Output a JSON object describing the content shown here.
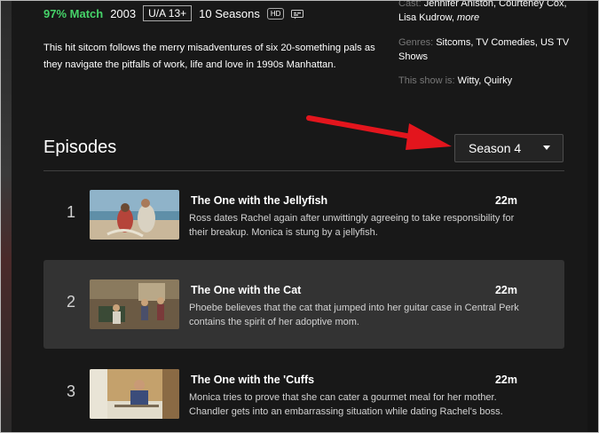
{
  "meta": {
    "match": "97% Match",
    "year": "2003",
    "rating": "U/A 13+",
    "seasons": "10 Seasons",
    "hd_badge": "HD",
    "subtitles_icon": "subtitles-icon"
  },
  "synopsis": "This hit sitcom follows the merry misadventures of six 20-something pals as they navigate the pitfalls of work, life and love in 1990s Manhattan.",
  "info": {
    "cast_label": "Cast:",
    "cast_value": "Jennifer Aniston, Courteney Cox, Lisa Kudrow,",
    "cast_more": "more",
    "genres_label": "Genres:",
    "genres_value": "Sitcoms, TV Comedies, US TV Shows",
    "tags_label": "This show is:",
    "tags_value": "Witty, Quirky"
  },
  "episodes_section": {
    "title": "Episodes",
    "season_selected": "Season 4"
  },
  "episodes": [
    {
      "number": "1",
      "title": "The One with the Jellyfish",
      "duration": "22m",
      "description": "Ross dates Rachel again after unwittingly agreeing to take responsibility for their breakup. Monica is stung by a jellyfish."
    },
    {
      "number": "2",
      "title": "The One with the Cat",
      "duration": "22m",
      "description": "Phoebe believes that the cat that jumped into her guitar case in Central Perk contains the spirit of her adoptive mom."
    },
    {
      "number": "3",
      "title": "The One with the 'Cuffs",
      "duration": "22m",
      "description": "Monica tries to prove that she can cater a gourmet meal for her mother. Chandler gets into an embarrassing situation while dating Rachel's boss."
    }
  ],
  "colors": {
    "background": "#181818",
    "match_green": "#46d369",
    "annotation_arrow": "#e3151d",
    "active_row": "#333333"
  }
}
